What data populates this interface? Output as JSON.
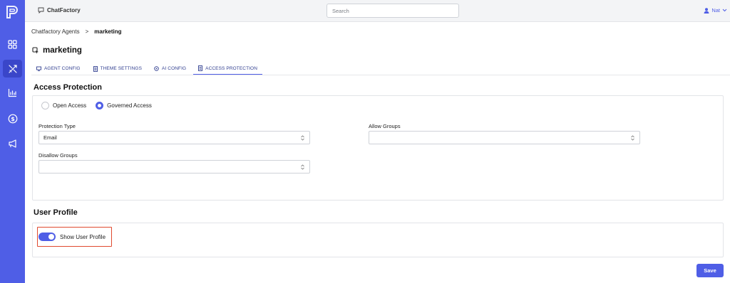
{
  "app": {
    "brand": "ChatFactory"
  },
  "search": {
    "placeholder": "Search"
  },
  "user": {
    "name": "Nat"
  },
  "sidebar": {
    "items": [
      {
        "icon": "dashboard-grid-icon",
        "active": false
      },
      {
        "icon": "agents-tools-icon",
        "active": true
      },
      {
        "icon": "analytics-chart-icon",
        "active": false
      },
      {
        "icon": "billing-dollar-icon",
        "active": false
      },
      {
        "icon": "megaphone-icon",
        "active": false
      }
    ]
  },
  "breadcrumb": {
    "parent": "Chatfactory Agents",
    "separator": ">",
    "current": "marketing"
  },
  "page": {
    "title": "marketing"
  },
  "tabs": [
    {
      "label": "AGENT CONFIG",
      "icon": "monitor-icon"
    },
    {
      "label": "THEME SETTINGS",
      "icon": "document-icon"
    },
    {
      "label": "AI CONFIG",
      "icon": "ai-config-icon"
    },
    {
      "label": "ACCESS PROTECTION",
      "icon": "document-icon",
      "active": true
    }
  ],
  "access": {
    "title": "Access Protection",
    "options": [
      {
        "label": "Open Access",
        "checked": false
      },
      {
        "label": "Governed Access",
        "checked": true
      }
    ],
    "protection_type": {
      "label": "Protection Type",
      "value": "Email"
    },
    "allow_groups": {
      "label": "Allow Groups",
      "value": ""
    },
    "disallow_groups": {
      "label": "Disallow Groups",
      "value": ""
    }
  },
  "profile": {
    "title": "User Profile",
    "toggle_label": "Show User Profile",
    "toggle_on": true
  },
  "actions": {
    "save": "Save"
  },
  "colors": {
    "accent": "#4f5ee6",
    "highlight_border": "#e0492f",
    "sidebar_active": "#3a46c9"
  }
}
